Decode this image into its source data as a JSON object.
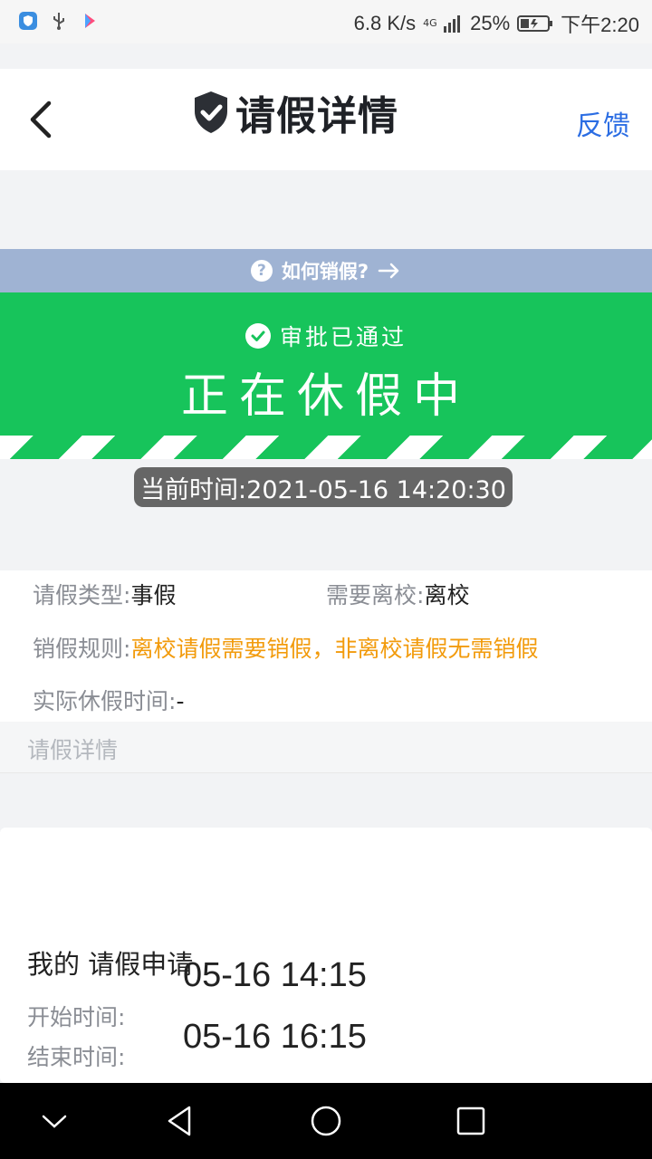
{
  "status_bar": {
    "speed": "6.8 K/s",
    "network": "4G",
    "battery": "25%",
    "time": "下午2:20",
    "icons": [
      "shield-app-icon",
      "usb-icon",
      "media-app-icon",
      "signal-icon",
      "battery-icon"
    ]
  },
  "header": {
    "title": "请假详情",
    "feedback": "反馈",
    "icons": [
      "back-arrow-icon",
      "shield-check-icon"
    ]
  },
  "howto": {
    "text": "如何销假?"
  },
  "status": {
    "approved": "审批已通过",
    "state": "正在休假中",
    "current_time": "当前时间:2021-05-16 14:20:30",
    "colors": {
      "green": "#17c45b",
      "howto_bg": "#9fb3d3",
      "orange": "#f29b0c",
      "link": "#2b6de3"
    }
  },
  "info": {
    "type_label": "请假类型:",
    "type_value": "事假",
    "leave_school_label": "需要离校:",
    "leave_school_value": "离校",
    "rule_label": "销假规则:",
    "rule_value": "离校请假需要销假，非离校请假无需销假",
    "actual_label": "实际休假时间:",
    "actual_value": "-"
  },
  "section": {
    "title": "请假详情"
  },
  "application": {
    "title": "我的 请假申请",
    "start_label": "开始时间:",
    "start_value": "05-16 14:15",
    "end_label": "结束时间:",
    "end_value": "05-16 16:15"
  },
  "navbar": {
    "icons": [
      "nav-down-icon",
      "nav-back-icon",
      "nav-home-icon",
      "nav-recent-icon"
    ]
  }
}
